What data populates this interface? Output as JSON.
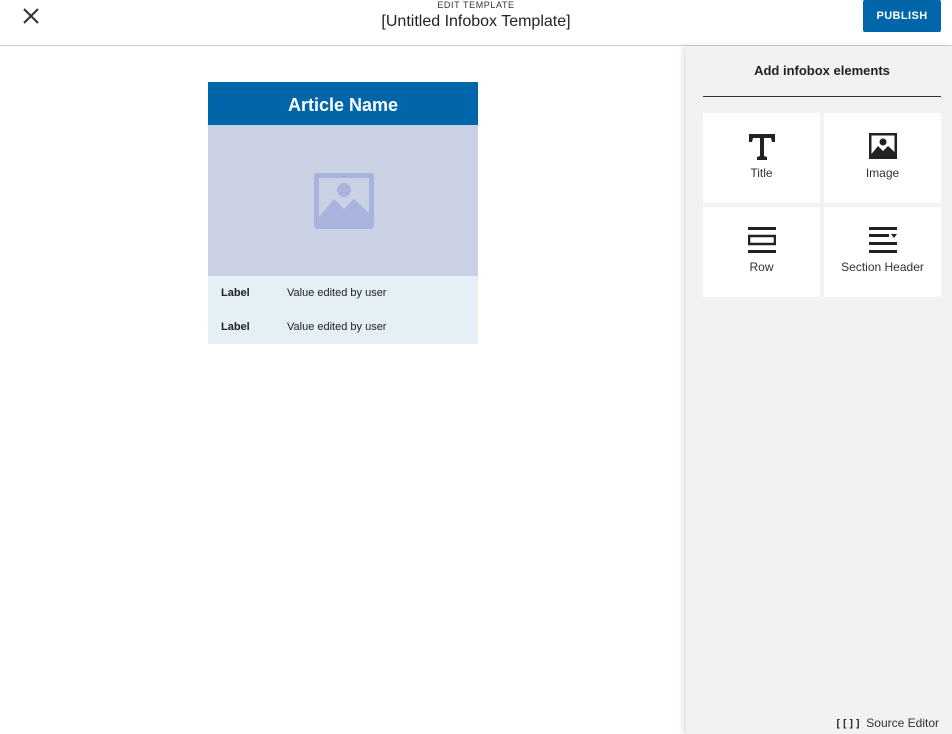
{
  "header": {
    "eyebrow": "EDIT TEMPLATE",
    "title": "[Untitled Infobox Template]",
    "publish_label": "PUBLISH",
    "close_icon": "close-icon"
  },
  "infobox": {
    "title": "Article Name",
    "image_icon": "image-placeholder-icon",
    "rows": [
      {
        "label": "Label",
        "value": "Value edited by user"
      },
      {
        "label": "Label",
        "value": "Value edited by user"
      }
    ]
  },
  "panel": {
    "heading": "Add infobox elements",
    "tiles": [
      {
        "label": "Title",
        "icon": "title-icon"
      },
      {
        "label": "Image",
        "icon": "image-icon"
      },
      {
        "label": "Row",
        "icon": "row-icon"
      },
      {
        "label": "Section Header",
        "icon": "section-header-icon"
      }
    ],
    "source_editor_icon": "[[]]",
    "source_editor_label": "Source Editor"
  },
  "colors": {
    "accent": "#0066aa",
    "image_bg": "#cbd1e4",
    "row_bg": "#e4eff6",
    "panel_bg": "#f2f2f2"
  }
}
